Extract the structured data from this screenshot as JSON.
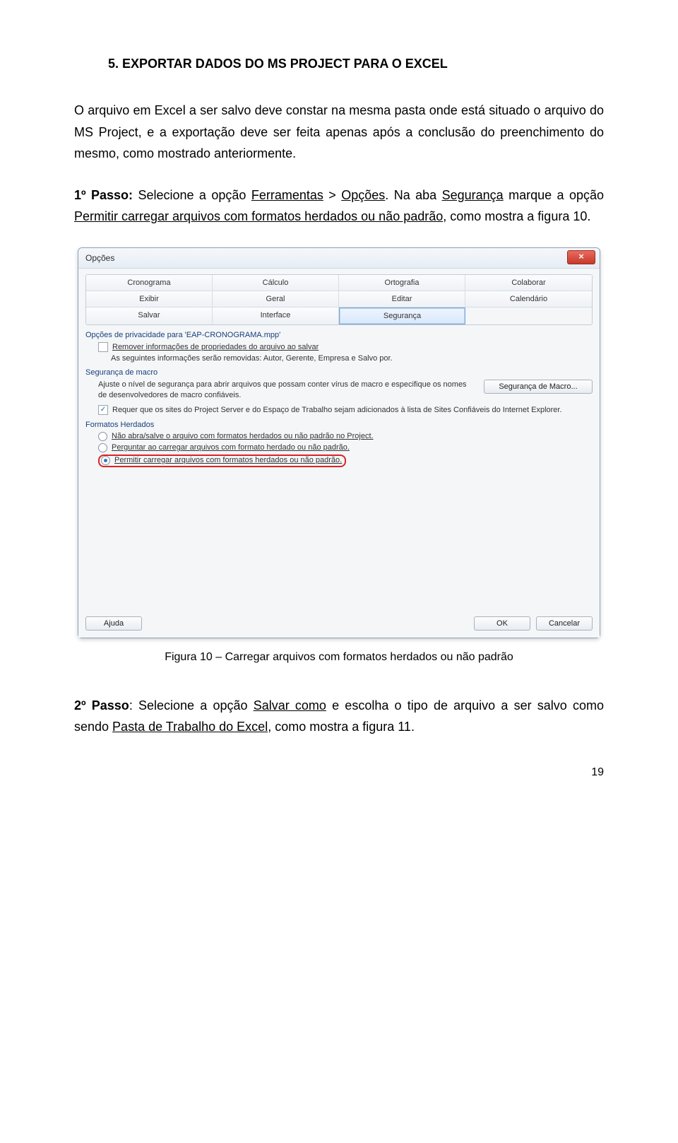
{
  "section_title": "5. EXPORTAR DADOS DO MS PROJECT PARA O EXCEL",
  "para1": "O arquivo em Excel a ser salvo deve constar na mesma pasta onde está situado o arquivo do MS Project, e a exportação deve ser feita apenas após a conclusão do preenchimento do mesmo, como mostrado anteriormente.",
  "passo1": {
    "label": "1º Passo:",
    "pre": " Selecione a opção ",
    "u1": "Ferramentas",
    "mid1": " > ",
    "u2": "Opções",
    "post1": ". Na aba ",
    "u3": "Segurança",
    "post2": " marque a opção ",
    "u4": "Permitir carregar arquivos com formatos herdados ou não padrão",
    "tail": ", como mostra a figura 10."
  },
  "dialog": {
    "title": "Opções",
    "close": "×",
    "tabs_row1": [
      "Cronograma",
      "Cálculo",
      "Ortografia",
      "Colaborar"
    ],
    "tabs_row2": [
      "Exibir",
      "Geral",
      "Editar",
      "Calendário"
    ],
    "tabs_row3": [
      "Salvar",
      "Interface",
      "Segurança",
      ""
    ],
    "group_privacy": "Opções de privacidade para 'EAP-CRONOGRAMA.mpp'",
    "chk_remove": "Remover informações de propriedades do arquivo ao salvar",
    "removed_info": "As seguintes informações serão removidas: Autor, Gerente, Empresa e Salvo por.",
    "group_macro": "Segurança de macro",
    "macro_text": "Ajuste o nível de segurança para abrir arquivos que possam conter vírus de macro e especifique os nomes de desenvolvedores de macro confiáveis.",
    "btn_macro": "Segurança de Macro...",
    "chk_requer": "Requer que os sites do Project Server e do Espaço de Trabalho sejam adicionados à lista de Sites Confiáveis do Internet Explorer.",
    "group_formats": "Formatos Herdados",
    "radio1": "Não abra/salve o arquivo com formatos herdados ou não padrão no Project.",
    "radio2": "Perguntar ao carregar arquivos com formato herdado ou não padrão.",
    "radio3": "Permitir carregar arquivos com formatos herdados ou não padrão.",
    "btn_help": "Ajuda",
    "btn_ok": "OK",
    "btn_cancel": "Cancelar"
  },
  "caption": "Figura 10 – Carregar arquivos com formatos herdados ou não padrão",
  "passo2": {
    "label": "2º Passo",
    "pre": ": Selecione a opção ",
    "u1": "Salvar como",
    "mid": " e escolha o tipo de arquivo a ser salvo como sendo ",
    "u2": "Pasta de Trabalho do Excel",
    "tail": ", como mostra a figura 11."
  },
  "page_number": "19"
}
